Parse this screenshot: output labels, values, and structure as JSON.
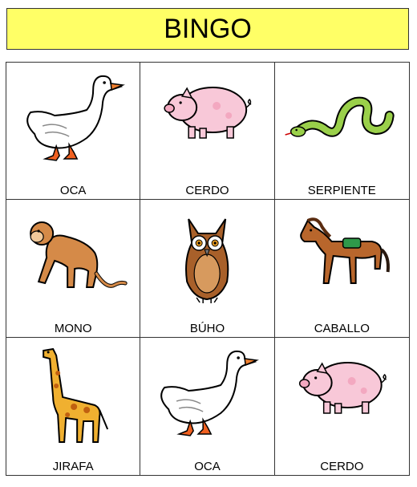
{
  "title": "BINGO",
  "cells": [
    {
      "label": "OCA",
      "icon": "goose-icon"
    },
    {
      "label": "CERDO",
      "icon": "pig-icon"
    },
    {
      "label": "SERPIENTE",
      "icon": "snake-icon"
    },
    {
      "label": "MONO",
      "icon": "monkey-icon"
    },
    {
      "label": "BÚHO",
      "icon": "owl-icon"
    },
    {
      "label": "CABALLO",
      "icon": "horse-icon"
    },
    {
      "label": "JIRAFA",
      "icon": "giraffe-icon"
    },
    {
      "label": "OCA",
      "icon": "goose-icon"
    },
    {
      "label": "CERDO",
      "icon": "pig-icon"
    }
  ],
  "colors": {
    "title_background": "#ffff66"
  }
}
